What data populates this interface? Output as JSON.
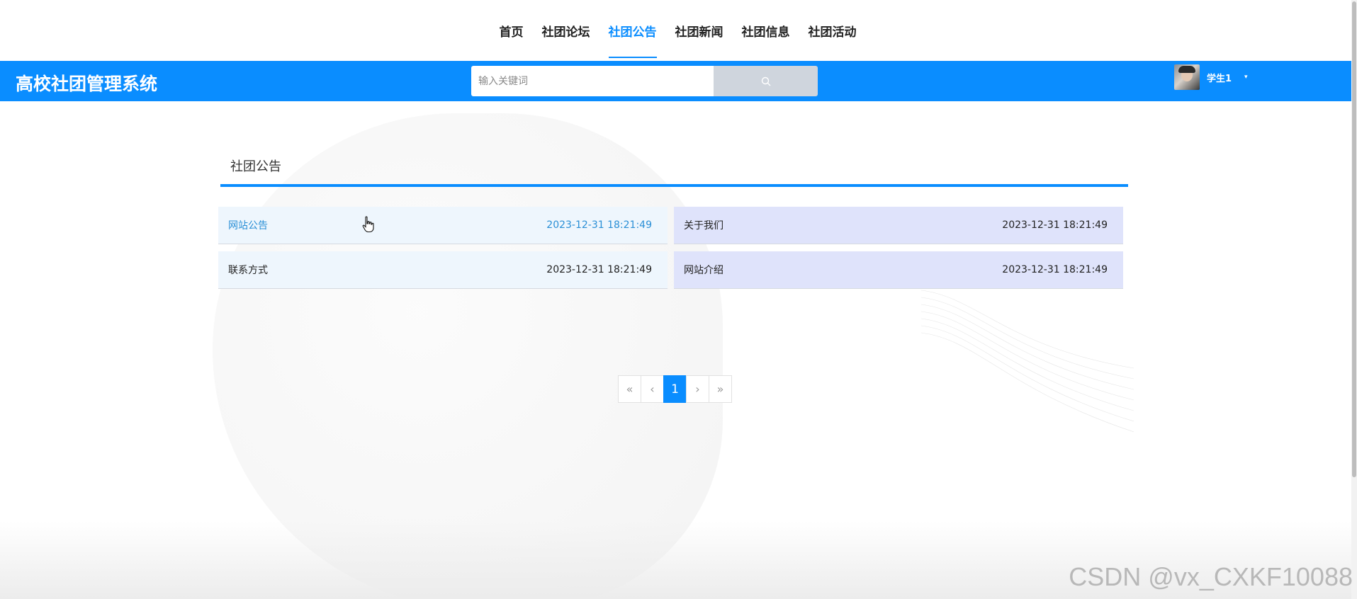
{
  "nav": {
    "items": [
      {
        "label": "首页",
        "active": false
      },
      {
        "label": "社团论坛",
        "active": false
      },
      {
        "label": "社团公告",
        "active": true
      },
      {
        "label": "社团新闻",
        "active": false
      },
      {
        "label": "社团信息",
        "active": false
      },
      {
        "label": "社团活动",
        "active": false
      }
    ]
  },
  "header": {
    "brand": "高校社团管理系统",
    "search_placeholder": "输入关键词",
    "search_icon": "search-icon",
    "user_name": "学生1",
    "user_caret": "▾"
  },
  "section": {
    "title": "社团公告"
  },
  "notices": [
    {
      "title": "网站公告",
      "date": "2023-12-31 18:21:49"
    },
    {
      "title": "关于我们",
      "date": "2023-12-31 18:21:49"
    },
    {
      "title": "联系方式",
      "date": "2023-12-31 18:21:49"
    },
    {
      "title": "网站介绍",
      "date": "2023-12-31 18:21:49"
    }
  ],
  "pagination": {
    "first": "«",
    "prev": "‹",
    "current": "1",
    "next": "›",
    "last": "»"
  },
  "colors": {
    "accent": "#0a8dff",
    "notice_light": "#eef6fd",
    "notice_lavender": "#dfe3fb"
  },
  "watermark": "CSDN @vx_CXKF10088"
}
